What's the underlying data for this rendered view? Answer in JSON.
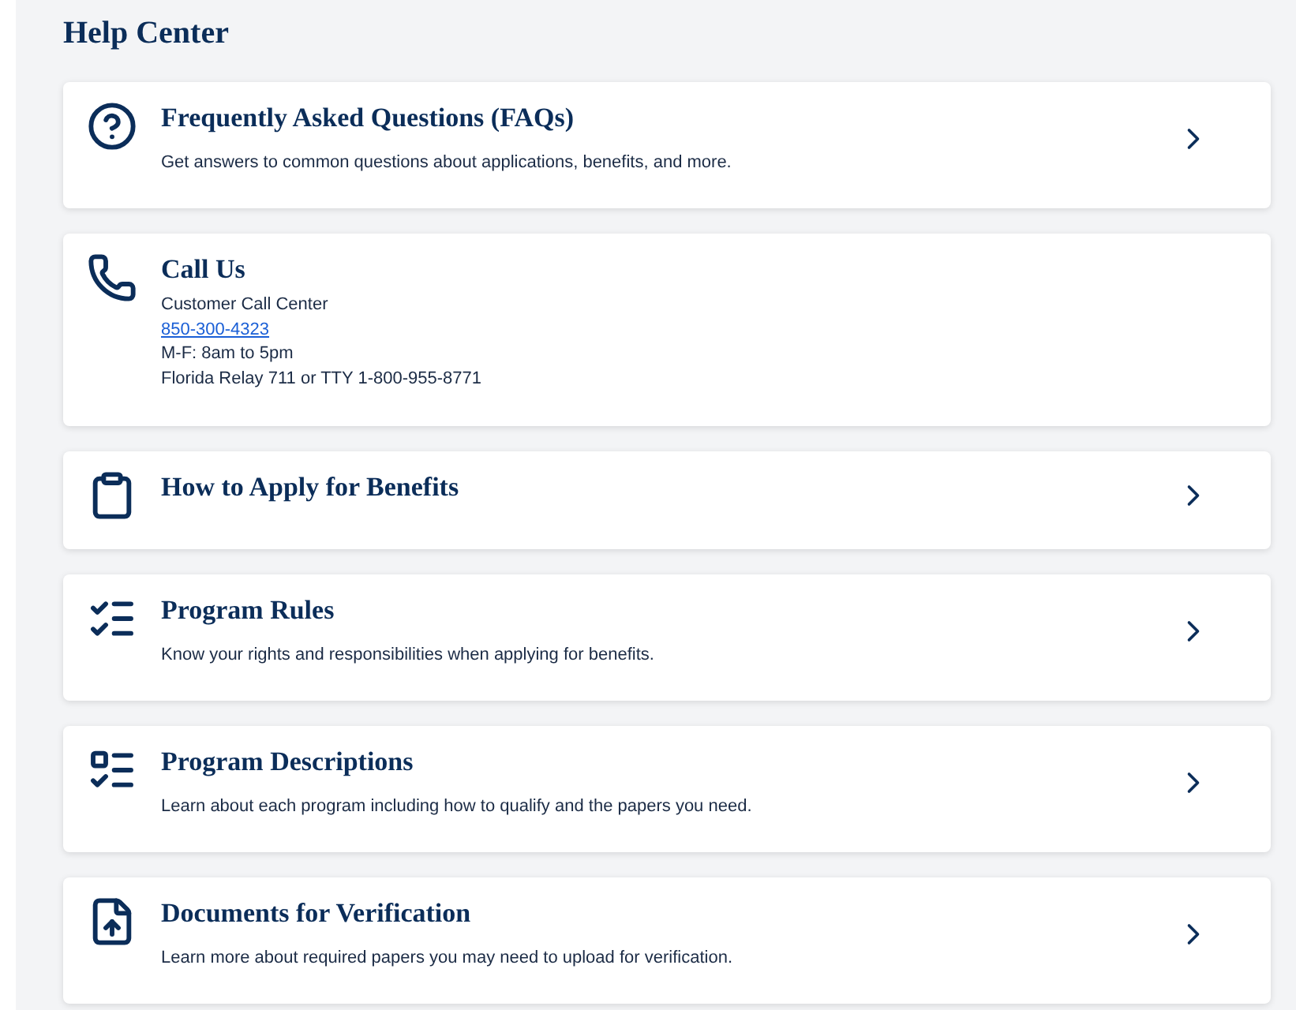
{
  "page_title": "Help Center",
  "cards": [
    {
      "kind": "link",
      "title": "Frequently Asked Questions (FAQs)",
      "description": "Get answers to common questions about applications, benefits, and more."
    },
    {
      "kind": "contact",
      "title": "Call Us",
      "lines": [
        {
          "kind": "text",
          "text": "Customer Call Center"
        },
        {
          "kind": "phone",
          "text": "850-300-4323"
        },
        {
          "kind": "text",
          "text": "M-F: 8am to 5pm"
        },
        {
          "kind": "text",
          "text": "Florida Relay 711 or TTY 1-800-955-8771"
        }
      ]
    },
    {
      "kind": "link",
      "title": "How to Apply for Benefits"
    },
    {
      "kind": "link",
      "title": "Program Rules",
      "description": "Know your rights and responsibilities when applying for benefits."
    },
    {
      "kind": "link",
      "title": "Program Descriptions",
      "description": "Learn about each program including how to qualify and the papers you need."
    },
    {
      "kind": "link",
      "title": "Documents for Verification",
      "description": "Learn more about required papers you may need to upload for verification."
    }
  ]
}
